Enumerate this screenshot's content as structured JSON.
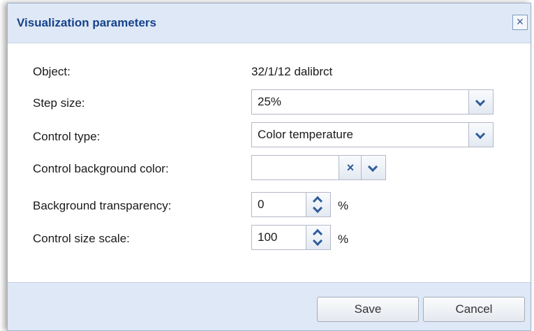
{
  "dialog": {
    "title": "Visualization parameters",
    "close_glyph": "×"
  },
  "fields": {
    "object": {
      "label": "Object:",
      "value": "32/1/12 dalibrct"
    },
    "step_size": {
      "label": "Step size:",
      "value": "25%"
    },
    "control_type": {
      "label": "Control type:",
      "value": "Color temperature"
    },
    "control_bg_color": {
      "label": "Control background color:",
      "value": ""
    },
    "bg_transparency": {
      "label": "Background transparency:",
      "value": "0",
      "unit": "%"
    },
    "control_size_scale": {
      "label": "Control size scale:",
      "value": "100",
      "unit": "%"
    }
  },
  "buttons": {
    "save": "Save",
    "cancel": "Cancel"
  },
  "icons": {
    "clear": "×"
  },
  "colors": {
    "title_text": "#15428b",
    "header_bg": "#dfe8f6",
    "trigger_icon": "#2f5d9b"
  }
}
